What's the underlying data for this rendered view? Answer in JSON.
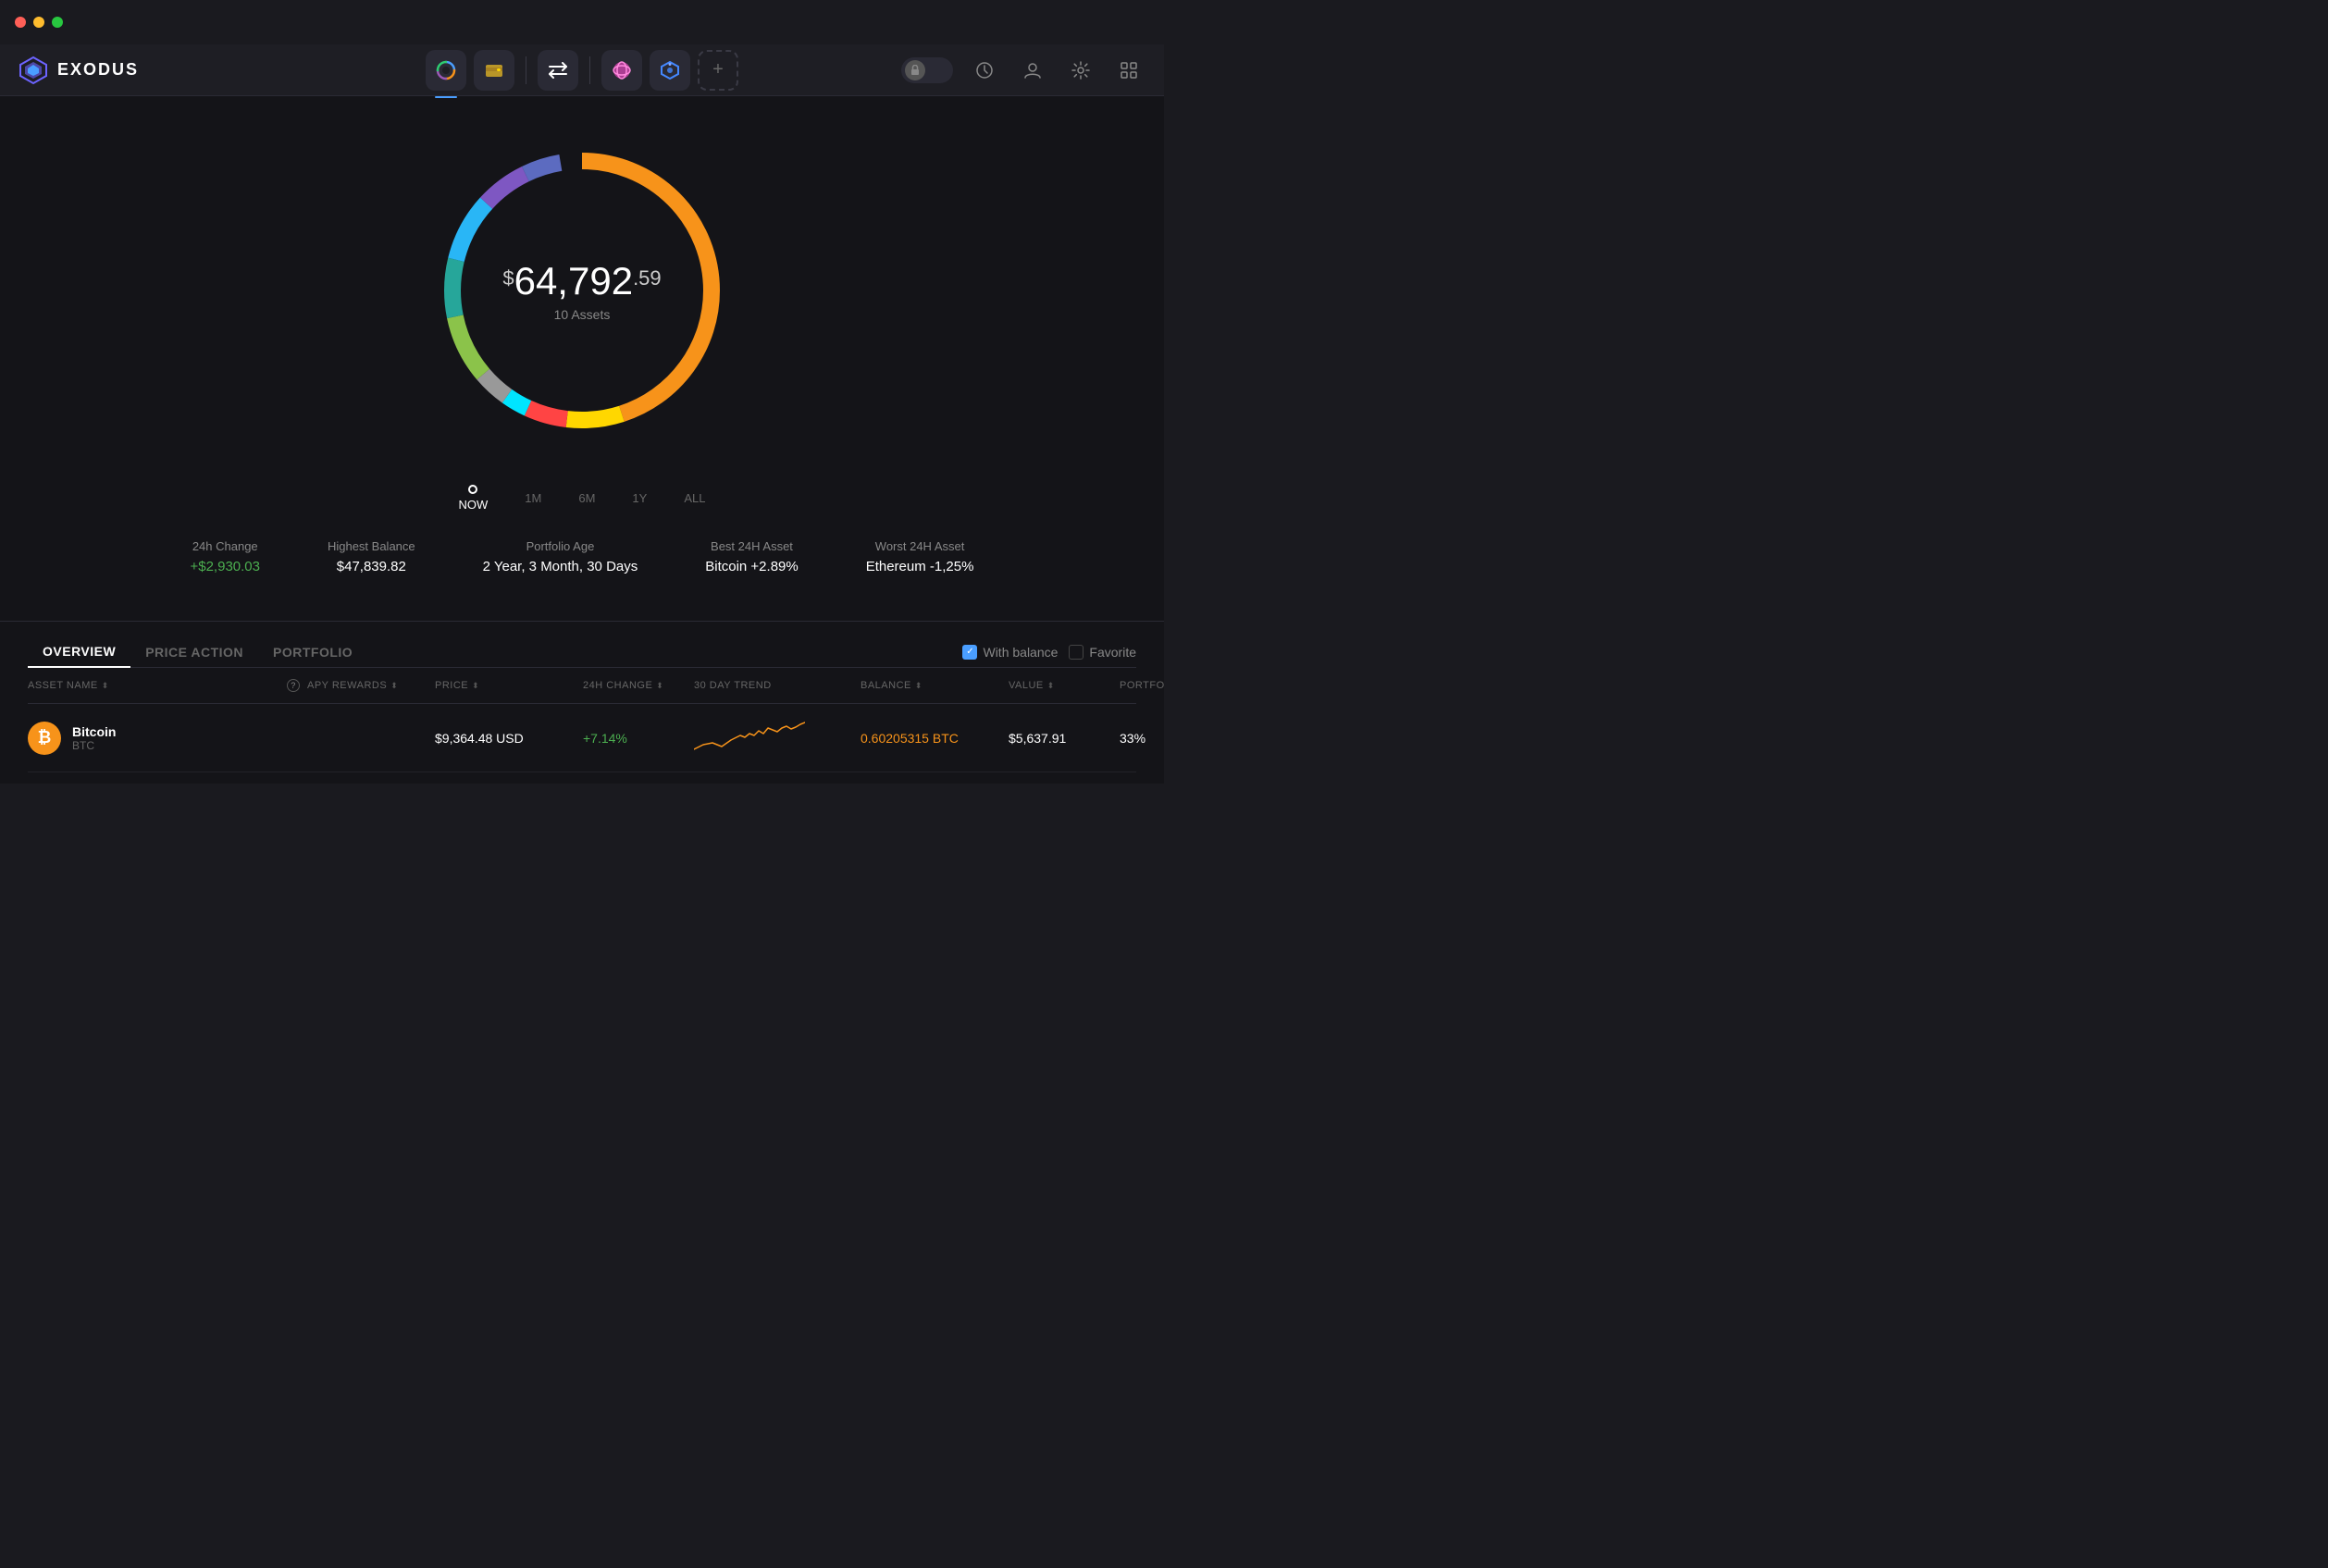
{
  "titlebar": {
    "traffic_lights": [
      "red",
      "yellow",
      "green"
    ]
  },
  "logo": {
    "text": "EXODUS"
  },
  "navbar": {
    "nav_buttons": [
      {
        "id": "portfolio",
        "label": "Portfolio",
        "active": true,
        "icon": "◑"
      },
      {
        "id": "wallet",
        "label": "Wallet",
        "active": false,
        "icon": "▣"
      },
      {
        "id": "exchange",
        "label": "Exchange",
        "active": false,
        "icon": "⇄"
      },
      {
        "id": "app1",
        "label": "App1",
        "active": false,
        "icon": "❋"
      },
      {
        "id": "app2",
        "label": "App2",
        "active": false,
        "icon": "⬡"
      }
    ],
    "add_button": "+",
    "right_buttons": [
      {
        "id": "lock",
        "label": "Lock"
      },
      {
        "id": "history",
        "label": "History",
        "icon": "🕐"
      },
      {
        "id": "account",
        "label": "Account",
        "icon": "⚙"
      },
      {
        "id": "settings",
        "label": "Settings",
        "icon": "⚙"
      },
      {
        "id": "apps",
        "label": "Apps",
        "icon": "⊞"
      }
    ]
  },
  "portfolio": {
    "total_value_dollar": "$",
    "total_value_main": "64,792",
    "total_value_cents": ".59",
    "assets_count": "10 Assets",
    "donut": {
      "segments": [
        {
          "color": "#f7931a",
          "percent": 45,
          "label": "Bitcoin"
        },
        {
          "color": "#ffd700",
          "percent": 10,
          "label": "Yellow"
        },
        {
          "color": "#ff4444",
          "percent": 5,
          "label": "Red"
        },
        {
          "color": "#00e5ff",
          "percent": 3,
          "label": "Cyan"
        },
        {
          "color": "#aaa",
          "percent": 4,
          "label": "Gray"
        },
        {
          "color": "#66bb6a",
          "percent": 8,
          "label": "Green"
        },
        {
          "color": "#4db6ac",
          "percent": 7,
          "label": "Teal"
        },
        {
          "color": "#29b6f6",
          "percent": 8,
          "label": "Blue"
        },
        {
          "color": "#7e57c2",
          "percent": 6,
          "label": "Purple"
        },
        {
          "color": "#4a9eff",
          "percent": 4,
          "label": "Indigo"
        }
      ]
    }
  },
  "timeline": {
    "items": [
      {
        "label": "NOW",
        "active": true
      },
      {
        "label": "1M",
        "active": false
      },
      {
        "label": "6M",
        "active": false
      },
      {
        "label": "1Y",
        "active": false
      },
      {
        "label": "ALL",
        "active": false
      }
    ]
  },
  "stats": [
    {
      "label": "24h Change",
      "value": "+$2,930.03",
      "positive": true
    },
    {
      "label": "Highest Balance",
      "value": "$47,839.82",
      "positive": false
    },
    {
      "label": "Portfolio Age",
      "value": "2 Year, 3 Month, 30 Days",
      "positive": false
    },
    {
      "label": "Best 24H Asset",
      "value": "Bitcoin +2.89%",
      "positive": false
    },
    {
      "label": "Worst 24H Asset",
      "value": "Ethereum -1,25%",
      "positive": false
    }
  ],
  "tabs": {
    "items": [
      {
        "label": "OVERVIEW",
        "active": true
      },
      {
        "label": "PRICE ACTION",
        "active": false
      },
      {
        "label": "PORTFOLIO",
        "active": false
      }
    ],
    "filters": [
      {
        "label": "With balance",
        "checked": true
      },
      {
        "label": "Favorite",
        "checked": false
      }
    ]
  },
  "table": {
    "headers": [
      {
        "label": "ASSET NAME"
      },
      {
        "label": "APY REWARDS",
        "has_help": true
      },
      {
        "label": "PRICE"
      },
      {
        "label": "24H CHANGE"
      },
      {
        "label": "30 DAY TREND"
      },
      {
        "label": "BALANCE"
      },
      {
        "label": "VALUE"
      },
      {
        "label": "PORTFOLIO %"
      }
    ],
    "rows": [
      {
        "icon_bg": "#f7931a",
        "icon_char": "₿",
        "name": "Bitcoin",
        "symbol": "BTC",
        "apy": "",
        "price": "$9,364.48 USD",
        "change": "+7.14%",
        "change_positive": true,
        "balance": "0.60205315 BTC",
        "balance_colored": true,
        "value": "$5,637.91",
        "portfolio": "33%",
        "sparkline_color": "#f7931a"
      }
    ]
  },
  "colors": {
    "bg_main": "#141418",
    "bg_nav": "#1e1e24",
    "accent_blue": "#4a9eff",
    "positive_green": "#4caf50",
    "bitcoin_orange": "#f7931a"
  }
}
